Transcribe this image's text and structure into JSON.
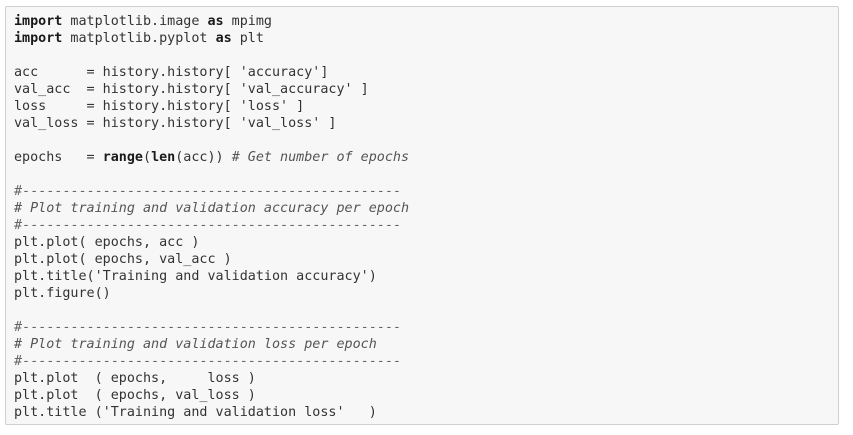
{
  "code_cell": {
    "lines": [
      [
        {
          "t": "kw",
          "s": "import"
        },
        {
          "t": "tx",
          "s": " matplotlib.image "
        },
        {
          "t": "kw",
          "s": "as"
        },
        {
          "t": "tx",
          "s": " mpimg"
        }
      ],
      [
        {
          "t": "kw",
          "s": "import"
        },
        {
          "t": "tx",
          "s": " matplotlib.pyplot "
        },
        {
          "t": "kw",
          "s": "as"
        },
        {
          "t": "tx",
          "s": " plt"
        }
      ],
      [],
      [
        {
          "t": "tx",
          "s": "acc      = history.history[ "
        },
        {
          "t": "st",
          "s": "'accuracy'"
        },
        {
          "t": "tx",
          "s": "]"
        }
      ],
      [
        {
          "t": "tx",
          "s": "val_acc  = history.history[ "
        },
        {
          "t": "st",
          "s": "'val_accuracy'"
        },
        {
          "t": "tx",
          "s": " ]"
        }
      ],
      [
        {
          "t": "tx",
          "s": "loss     = history.history[ "
        },
        {
          "t": "st",
          "s": "'loss'"
        },
        {
          "t": "tx",
          "s": " ]"
        }
      ],
      [
        {
          "t": "tx",
          "s": "val_loss = history.history[ "
        },
        {
          "t": "st",
          "s": "'val_loss'"
        },
        {
          "t": "tx",
          "s": " ]"
        }
      ],
      [],
      [
        {
          "t": "tx",
          "s": "epochs   = "
        },
        {
          "t": "bi",
          "s": "range"
        },
        {
          "t": "tx",
          "s": "("
        },
        {
          "t": "bi",
          "s": "len"
        },
        {
          "t": "tx",
          "s": "(acc)) "
        },
        {
          "t": "cm",
          "s": "# Get number of epochs"
        }
      ],
      [],
      [
        {
          "t": "dv",
          "s": "#-----------------------------------------------"
        }
      ],
      [
        {
          "t": "cm",
          "s": "# Plot training and validation accuracy per epoch"
        }
      ],
      [
        {
          "t": "dv",
          "s": "#-----------------------------------------------"
        }
      ],
      [
        {
          "t": "tx",
          "s": "plt.plot( epochs, acc )"
        }
      ],
      [
        {
          "t": "tx",
          "s": "plt.plot( epochs, val_acc )"
        }
      ],
      [
        {
          "t": "tx",
          "s": "plt.title("
        },
        {
          "t": "st",
          "s": "'Training and validation accuracy'"
        },
        {
          "t": "tx",
          "s": ")"
        }
      ],
      [
        {
          "t": "tx",
          "s": "plt.figure()"
        }
      ],
      [],
      [
        {
          "t": "dv",
          "s": "#-----------------------------------------------"
        }
      ],
      [
        {
          "t": "cm",
          "s": "# Plot training and validation loss per epoch"
        }
      ],
      [
        {
          "t": "dv",
          "s": "#-----------------------------------------------"
        }
      ],
      [
        {
          "t": "tx",
          "s": "plt.plot  ( epochs,     loss )"
        }
      ],
      [
        {
          "t": "tx",
          "s": "plt.plot  ( epochs, val_loss )"
        }
      ],
      [
        {
          "t": "tx",
          "s": "plt.title ("
        },
        {
          "t": "st",
          "s": "'Training and validation loss'"
        },
        {
          "t": "tx",
          "s": "   )"
        }
      ]
    ]
  }
}
